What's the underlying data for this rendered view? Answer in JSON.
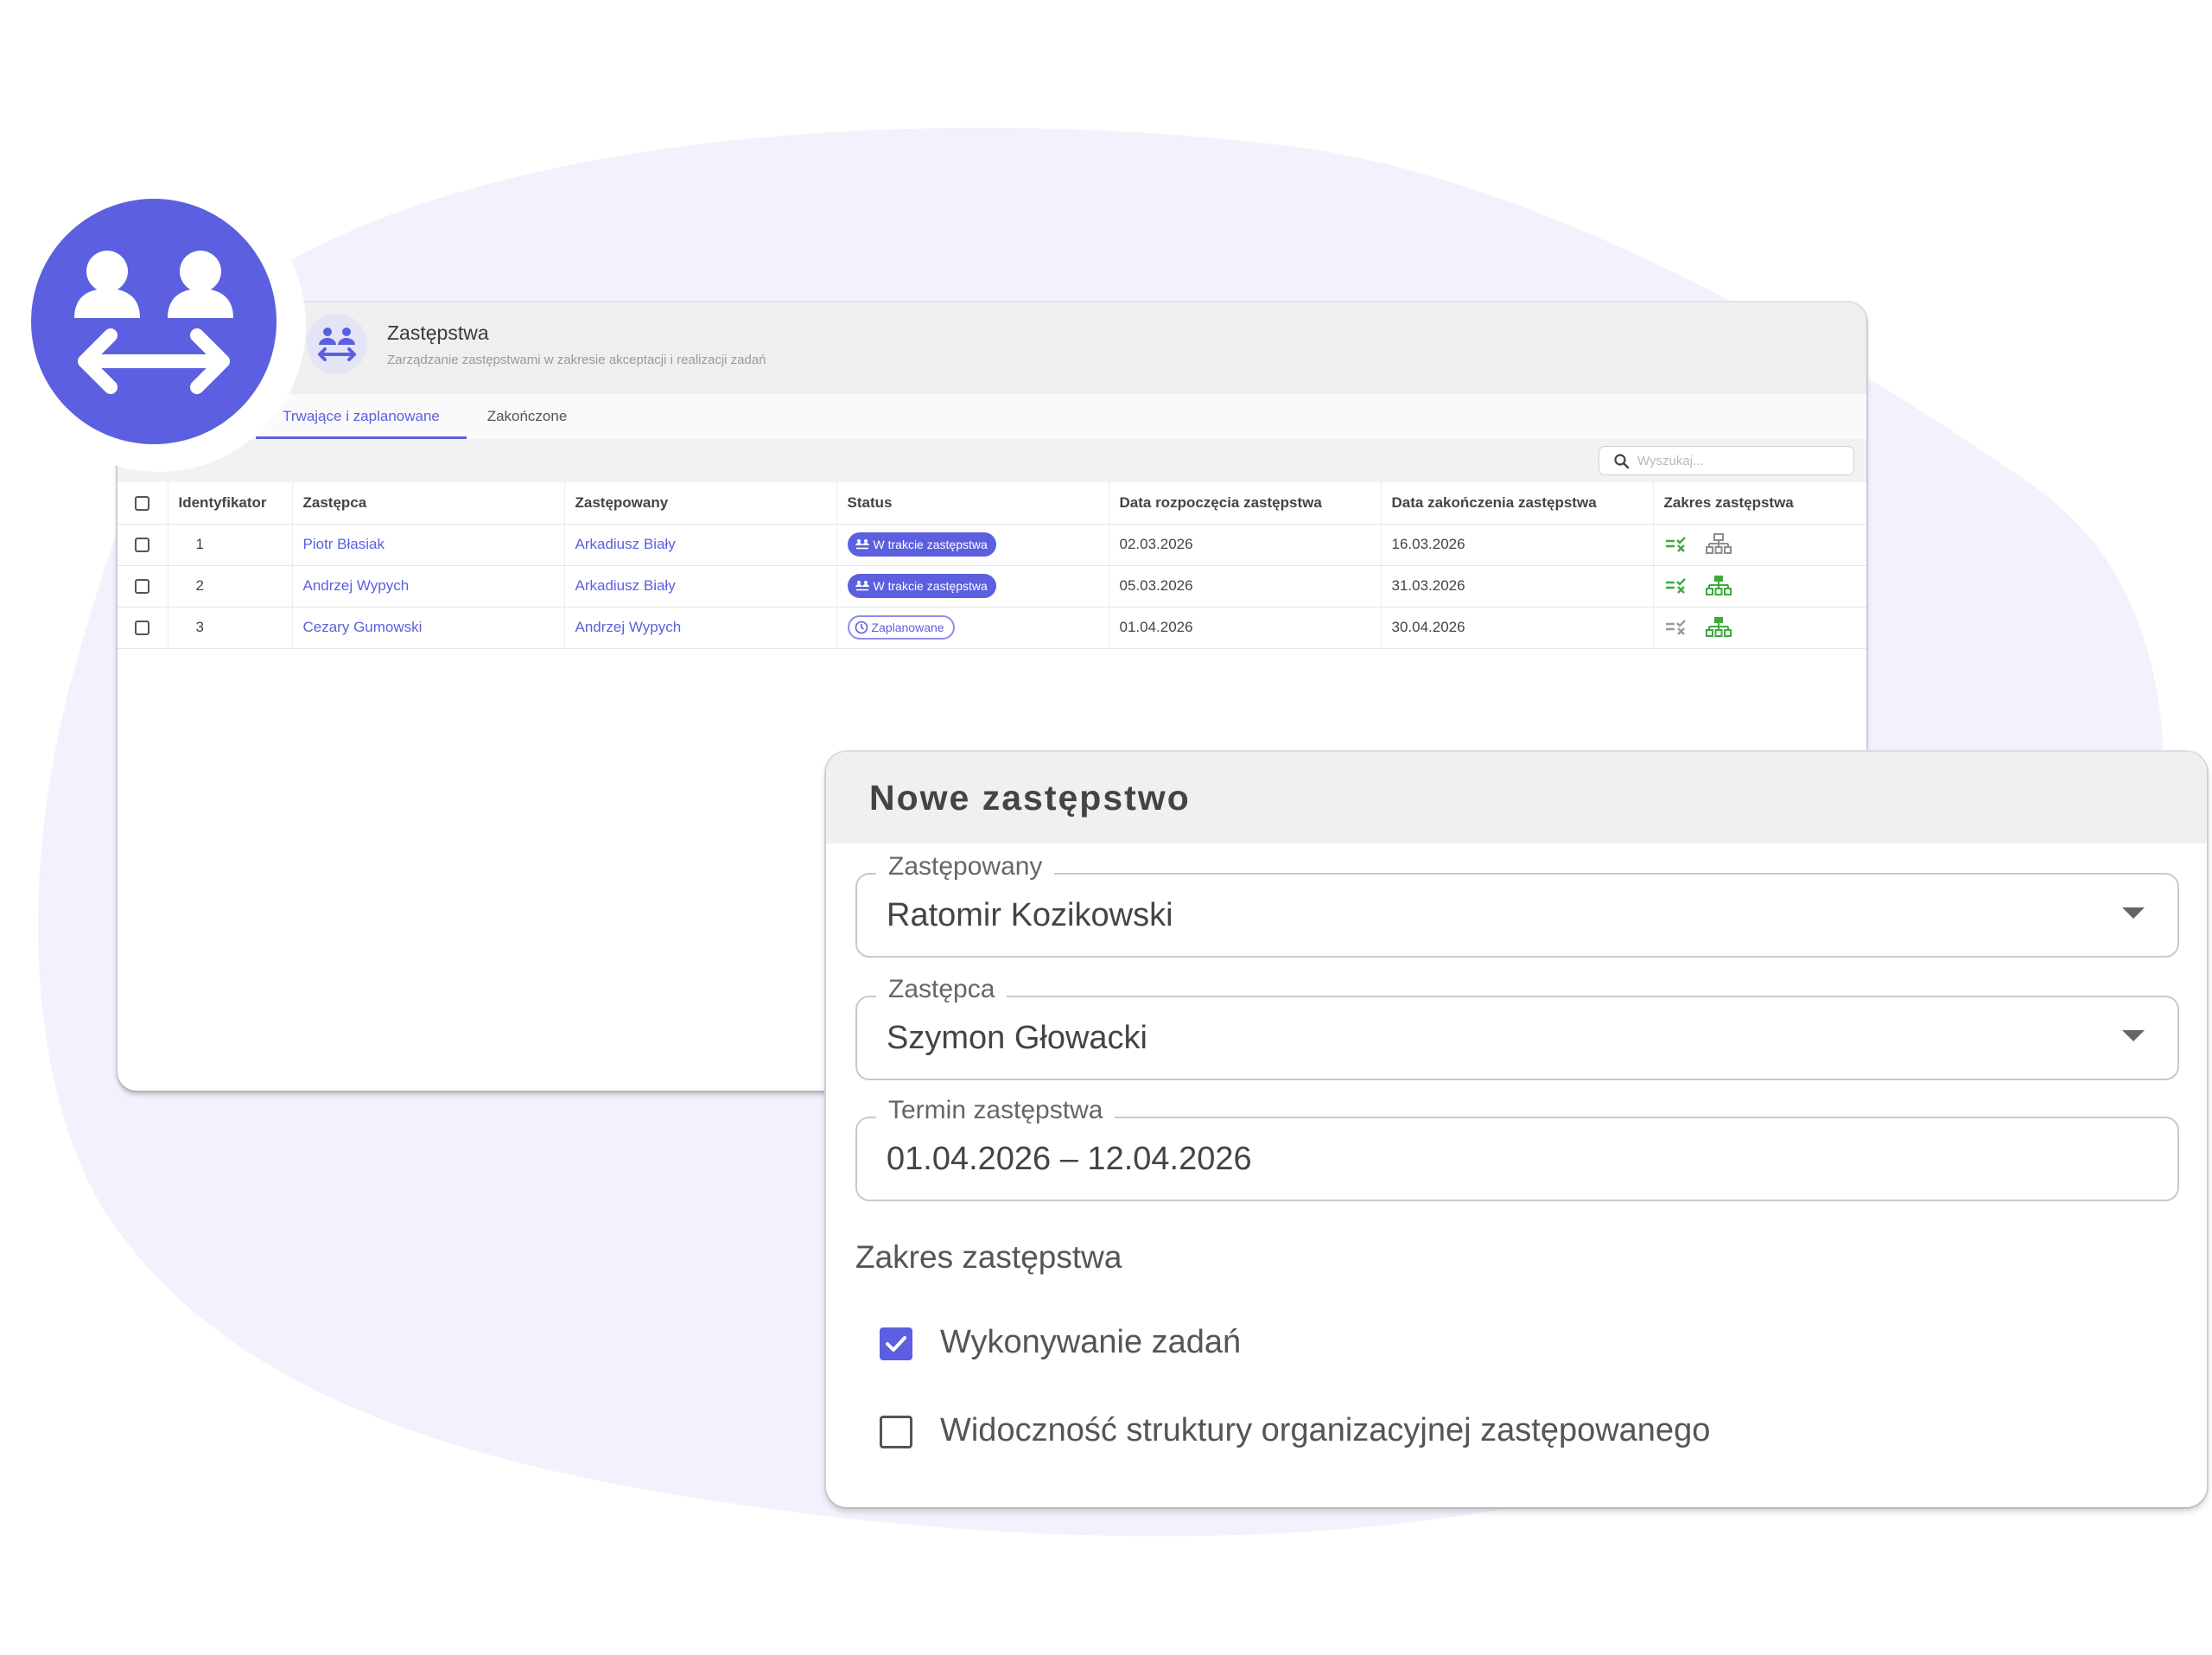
{
  "colors": {
    "accent": "#5b5fe0",
    "success_green": "#3daa3d",
    "blob": "#f2f2fd"
  },
  "module": {
    "title": "Zastępstwa",
    "subtitle": "Zarządzanie zastępstwami w zakresie akceptacji i realizacji zadań"
  },
  "tabs": [
    {
      "label": "Trwające i zaplanowane",
      "active": true
    },
    {
      "label": "Zakończone",
      "active": false
    }
  ],
  "search": {
    "placeholder": "Wyszukaj..."
  },
  "table": {
    "columns": [
      "Identyfikator",
      "Zastępca",
      "Zastępowany",
      "Status",
      "Data rozpoczęcia zastępstwa",
      "Data zakończenia zastępstwa",
      "Zakres zastępstwa"
    ],
    "rows": [
      {
        "id": "1",
        "deputy": "Piotr Błasiak",
        "replaced": "Arkadiusz Biały",
        "status": "W trakcie zastępstwa",
        "status_type": "active",
        "start": "02.03.2026",
        "end": "16.03.2026",
        "tasks_icon": "green",
        "structure_icon": "gray"
      },
      {
        "id": "2",
        "deputy": "Andrzej Wypych",
        "replaced": "Arkadiusz Biały",
        "status": "W trakcie zastępstwa",
        "status_type": "active",
        "start": "05.03.2026",
        "end": "31.03.2026",
        "tasks_icon": "green",
        "structure_icon": "green"
      },
      {
        "id": "3",
        "deputy": "Cezary Gumowski",
        "replaced": "Andrzej Wypych",
        "status": "Zaplanowane",
        "status_type": "planned",
        "start": "01.04.2026",
        "end": "30.04.2026",
        "tasks_icon": "gray",
        "structure_icon": "green"
      }
    ]
  },
  "dialog": {
    "title": "Nowe zastępstwo",
    "fields": {
      "replaced": {
        "label": "Zastępowany",
        "value": "Ratomir Kozikowski"
      },
      "deputy": {
        "label": "Zastępca",
        "value": "Szymon Głowacki"
      },
      "term": {
        "label": "Termin zastępstwa",
        "value": "01.04.2026 – 12.04.2026"
      }
    },
    "scope_title": "Zakres zastępstwa",
    "options": [
      {
        "label": "Wykonywanie zadań",
        "checked": true
      },
      {
        "label": "Widoczność struktury organizacyjnej zastępowanego",
        "checked": false
      }
    ]
  }
}
